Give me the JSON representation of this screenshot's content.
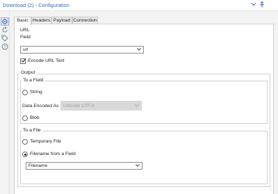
{
  "window": {
    "title": "Download (2) - Configuration",
    "menu_icon": "chevron-down-icon",
    "pin_icon": "pin-icon"
  },
  "sidebar": {
    "icons": [
      "gear-icon",
      "cycle-icon",
      "tag-icon",
      "help-icon"
    ],
    "active_index": 0
  },
  "tabs": [
    "Basic",
    "Headers",
    "Payload",
    "Connection"
  ],
  "active_tab": "Basic",
  "url_section": {
    "title": "URL",
    "field_label": "Field",
    "field_value": "url",
    "encode_label": "Encode URL Text",
    "encode_checked": true
  },
  "output": {
    "title": "Output",
    "to_field": {
      "title": "To a Field",
      "string_label": "String",
      "data_encoded_label": "Data Encoded As",
      "data_encoded_value": "Unicode UTF-8",
      "blob_label": "Blob"
    },
    "to_file": {
      "title": "To a File",
      "temp_label": "Temporary File",
      "from_field_label": "Filename from a Field",
      "from_field_selected": true,
      "filename_value": "Filename"
    }
  },
  "colors": {
    "title_blue": "#3f6cb0",
    "border": "#cfcfcf",
    "disabled_bg": "#d9d9d9"
  }
}
